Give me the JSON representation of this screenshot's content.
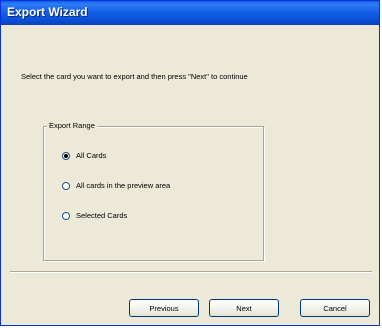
{
  "window": {
    "title": "Export Wizard"
  },
  "instruction": "Select the card you want to export and then press \"Next\" to continue",
  "export_range": {
    "legend": "Export Range",
    "options": [
      {
        "label": "All Cards",
        "selected": true
      },
      {
        "label": "All cards in the preview area",
        "selected": false
      },
      {
        "label": "Selected Cards",
        "selected": false
      }
    ]
  },
  "buttons": {
    "previous": "Previous",
    "next": "Next",
    "cancel": "Cancel"
  },
  "colors": {
    "titlebar": "#0a54e0",
    "dialog_bg": "#ece9d8",
    "button_border": "#003c74"
  }
}
